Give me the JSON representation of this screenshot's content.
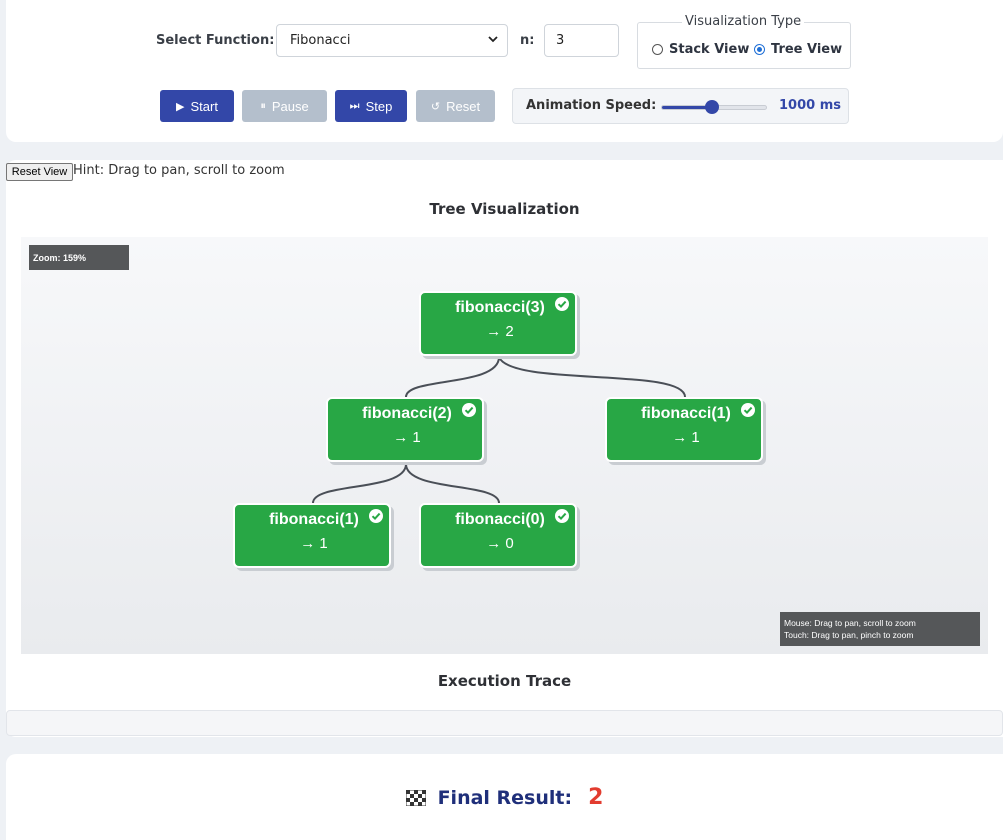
{
  "controls": {
    "select_function_label": "Select Function:",
    "selected_function": "Fibonacci",
    "n_label": "n:",
    "n_value": "3",
    "viz_type_legend": "Visualization Type",
    "viz_options": [
      {
        "label": "Stack View",
        "checked": false
      },
      {
        "label": "Tree View",
        "checked": true
      }
    ],
    "buttons": {
      "start": "Start",
      "pause": "Pause",
      "step": "Step",
      "reset": "Reset"
    },
    "speed_label": "Animation Speed:",
    "speed_value": "1000 ms",
    "speed_slider_level_percent": 48
  },
  "visualization": {
    "reset_view_label": "Reset View",
    "hint": "Hint: Drag to pan, scroll to zoom",
    "title": "Tree Visualization",
    "zoom_label": "Zoom: 159%",
    "mouse_hint": "Mouse: Drag to pan, scroll to zoom",
    "touch_hint": "Touch: Drag to pan, pinch to zoom",
    "nodes": [
      {
        "name": "fibonacci(3)",
        "result": "→ 2",
        "status": "complete"
      },
      {
        "name": "fibonacci(2)",
        "result": "→ 1",
        "status": "complete"
      },
      {
        "name": "fibonacci(1)",
        "result": "→ 1",
        "status": "complete"
      },
      {
        "name": "fibonacci(1)",
        "result": "→ 1",
        "status": "complete"
      },
      {
        "name": "fibonacci(0)",
        "result": "→ 0",
        "status": "complete"
      }
    ],
    "node_color": "#28a745",
    "trace_title": "Execution Trace"
  },
  "result": {
    "label": "Final Result:",
    "value": "2",
    "icon": "checkered-flag-icon"
  },
  "colors": {
    "primary": "#3347a8",
    "disabled": "#b4bfcc",
    "result_value": "#e23c2f"
  }
}
